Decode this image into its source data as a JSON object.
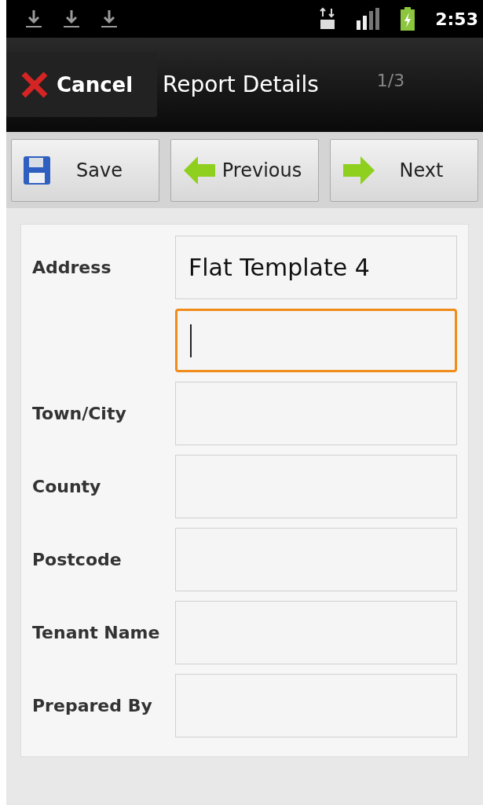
{
  "status_bar": {
    "notifications": [
      {
        "kind": "download"
      },
      {
        "kind": "download"
      },
      {
        "kind": "download"
      }
    ],
    "time": "2:53"
  },
  "action_bar": {
    "cancel": "Cancel",
    "title": "Report Details",
    "page": "1/3"
  },
  "toolbar": [
    {
      "kind": "save",
      "label": "Save"
    },
    {
      "kind": "previous",
      "label": "Previous"
    },
    {
      "kind": "next",
      "label": "Next"
    }
  ],
  "fields": [
    {
      "label": "Address",
      "value": "Flat Template 4",
      "focused": false
    },
    {
      "focused": true
    },
    {
      "label": "Town/City",
      "focused": false
    },
    {
      "label": "County",
      "focused": false
    },
    {
      "label": "Postcode",
      "focused": false
    },
    {
      "label": "Tenant Name",
      "focused": false
    },
    {
      "label": "Prepared By",
      "focused": false
    }
  ]
}
